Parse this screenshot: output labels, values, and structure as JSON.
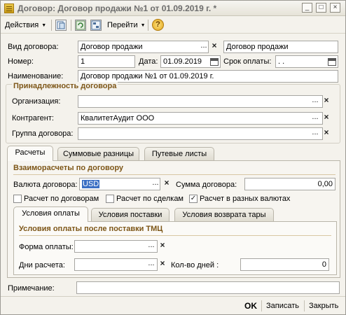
{
  "window": {
    "title": "Договор: Договор  продажи №1 от 01.09.2019 г. *",
    "controls": {
      "minimize": "_",
      "maximize": "□",
      "close": "×"
    }
  },
  "toolbar": {
    "actions": "Действия",
    "goto": "Перейти",
    "help": "?"
  },
  "header": {
    "contract_type_label": "Вид договора:",
    "contract_type_value": "Договор  продажи",
    "contract_type_text": "Договор  продажи",
    "number_label": "Номер:",
    "number_value": "1",
    "date_label": "Дата:",
    "date_value": "01.09.2019",
    "term_label": "Срок оплаты:",
    "term_value": " .  .",
    "name_label": "Наименование:",
    "name_value": "Договор  продажи №1 от 01.09.2019 г."
  },
  "affiliation": {
    "title": "Принадлежность договора",
    "org_label": "Организация:",
    "org_value": "",
    "counterparty_label": "Контрагент:",
    "counterparty_value": "КвалитетАудит ООО",
    "group_label": "Группа договора:",
    "group_value": ""
  },
  "tabs": [
    {
      "label": "Расчеты",
      "active": true
    },
    {
      "label": "Суммовые разницы",
      "active": false
    },
    {
      "label": "Путевые листы",
      "active": false
    }
  ],
  "settlements": {
    "title": "Взаиморасчеты по договору",
    "currency_label": "Валюта договора:",
    "currency_value": "USD",
    "sum_label": "Сумма договора:",
    "sum_value": "0,00",
    "chk_contracts_label": "Расчет по договорам",
    "chk_contracts": false,
    "chk_deals_label": "Расчет по сделкам",
    "chk_deals": false,
    "chk_currencies_label": "Расчет в разных валютах",
    "chk_currencies": true
  },
  "subtabs": [
    {
      "label": "Условия оплаты",
      "active": true
    },
    {
      "label": "Условия поставки",
      "active": false
    },
    {
      "label": "Условия возврата тары",
      "active": false
    }
  ],
  "payment_terms": {
    "title": "Условия оплаты после поставки ТМЦ",
    "form_label": "Форма оплаты:",
    "form_value": "",
    "days_label": "Дни расчета:",
    "days_value": "",
    "count_label": "Кол-во дней :",
    "count_value": "0"
  },
  "note": {
    "label": "Примечание:",
    "value": ""
  },
  "footer": {
    "ok": "OK",
    "save": "Записать",
    "close": "Закрыть"
  },
  "glyphs": {
    "ellipsis": "...",
    "clear": "×",
    "check": "✓"
  },
  "colors": {
    "section_title": "#7d5617",
    "selection": "#3b6fc4"
  }
}
